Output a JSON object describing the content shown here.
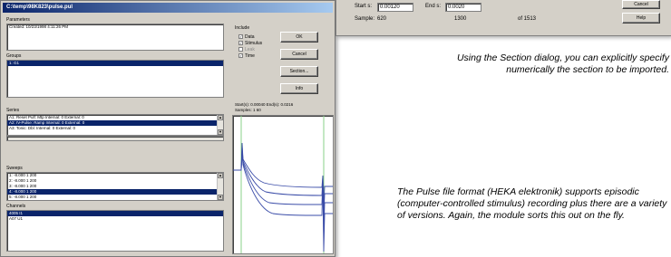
{
  "window": {
    "title": "C:\\temp\\98K823\\pulse.pul",
    "parameters_label": "Parameters",
    "parameters_text": "Created: 10/23/1998 4:11:26 PM",
    "groups_label": "Groups",
    "groups": [
      "1: G1"
    ],
    "series_label": "Series",
    "series": [
      "A1: Reset Pulf: Mtp Internal: 0 External: 0",
      "A2: IV-Pulse: Ramp Internal: 0 External: 0",
      "A3: Tonic: Dbl: Internal: 0 External: 0"
    ],
    "sweeps_label": "Sweeps",
    "sweeps": [
      "1:   -8.000  1  200",
      "2:   -8.000  1  200",
      "3:   -8.000  1  200",
      "4:   -8.000  1  200",
      "5:   -8.000  1  200"
    ],
    "channels_label": "Channels",
    "channels": [
      "4005 I1",
      "A07 U1"
    ],
    "include_label": "Include",
    "include": [
      {
        "label": "Data",
        "checked": true,
        "enabled": true
      },
      {
        "label": "Stimulus",
        "checked": true,
        "enabled": true
      },
      {
        "label": "Leak",
        "checked": false,
        "enabled": false
      },
      {
        "label": "Time",
        "checked": true,
        "enabled": true
      }
    ],
    "buttons": {
      "ok": "OK",
      "cancel": "Cancel",
      "section": "Section...",
      "info": "Info"
    },
    "start_end_text": "Start(s): 0.00040  End(s): 0.0216",
    "samples_text": "Samples: 1 60"
  },
  "section_dialog": {
    "start_label": "Start s:",
    "start_value": "0.00120",
    "end_label": "End s:",
    "end_value": "0.0020",
    "samples_label": "Sample:",
    "samples_value": "620",
    "mid_value": "1300",
    "of_text": "of 1513",
    "cancel": "Cancel",
    "help": "Help"
  },
  "captions": {
    "section": "Using the Section dialog, you can explicitly specify numerically the section to be imported.",
    "pulse": "The Pulse file format (HEKA elektronik) supports episodic (computer-controlled stimulus) recording plus there are a variety of versions. Again, the module sorts this out on the fly."
  }
}
